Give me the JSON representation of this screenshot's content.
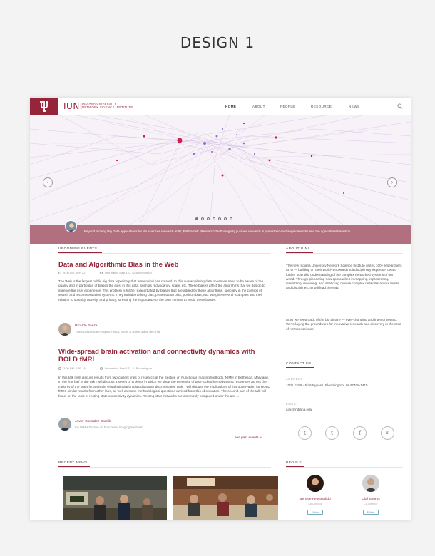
{
  "design_title": "DESIGN 1",
  "header": {
    "logo_mark": "IUNI",
    "org_line1": "INDIANA UNIVERSITY",
    "org_line2": "NETWORK SCIENCE INSTITUTE",
    "nav": [
      "HOME",
      "ABOUT",
      "PEOPLE",
      "RESOURCE",
      "NEWS"
    ],
    "active_nav": "HOME"
  },
  "hero": {
    "caption": "Beyond moving Big Data applications for life sciences research at IU, Bill Barnett (Research Technologies) pursues research in prehistoric exchange networks and the agricultural transition.",
    "slide_count": 7,
    "active_slide": 1
  },
  "events": {
    "section_label": "UPCOMING EVENTS",
    "items": [
      {
        "title": "Data and Algorithmic Bias in the Web",
        "time": "9:00 AM, APR 22",
        "location": "Informatics East 122, IU Bloomington",
        "description": "The Web is the largest public big data repository that humankind has created. In this overwhelming data ocean we need to be aware of the quality and in particular, of biases the exist in this data, such as redundancy, spam, etc. These biases affect the algorithms that we design to improve the user experience. This problem is further exacerbated by biases that are added by these algorithms, specially in the context of search and recommendation systems. They include ranking bias, presentation bias, position bias, etc. We give several examples and their relation to sparsity, novelty, and privacy, stressing the importance of the user context to avoid these biases.",
        "speaker": "Ricardo Baeza",
        "affiliation": "Yates Universitat Pompeu Fabra, Spain & Universidad de Chile"
      },
      {
        "title": "Wide-spread brain activation and connectivity dynamics with BOLD fMRI",
        "time": "3:00 PM, APR 18",
        "location": "Informatics East 122, IU Bloomington",
        "description": "In this talk I will discuss results from two current lines of research at the Section on Functional Imaging Methods, NIMH in Bethesda, Maryland. In the first half of the talk I will discuss a series of projects in which we show the presence of task-locked hemodynamic responses across the majority of the brain for a simple visual stimulation plus character discrimination task. I will discuss the implications of this observation for BOLD fMRI, similar results from other labs, as well as some methodological questions derived from this observation. The second part of the talk will focus on the topic of resting state connectivity dynamics. Resting state networks are commonly computed under the ass ...",
        "speaker": "Javier Gonzalez Castillo",
        "affiliation": "the NIMH Section on Functional Imaging Methods"
      }
    ],
    "see_past": "see past events >"
  },
  "about": {
    "section_label": "ABOUT IUNI",
    "para1": "The new Indiana University Network Science Institute unites 100+ researchers at IU — building on their world-renowned multidisciplinary expertise toward further scientific understanding of the complex networked systems of our world. Through pioneering new approaches in mapping, representing, visualizing, modeling, and analyzing diverse complex networks across levels and disciplines, IU will lead the way.",
    "para2": "At IU we keep track of the big picture — ever-changing and interconnected. We're laying the groundwork for innovative research and discovery in the area of network science."
  },
  "contact": {
    "section_label": "CONTACT US",
    "address_label": "ADDRESS",
    "address": "1001 E SR 45/46 Bypass, Bloomington, IN 47408-1415",
    "email_label": "EMAIL",
    "email": "iuni@indiana.edu",
    "social_icons": [
      "twitter-icon",
      "tumblr-icon",
      "facebook-icon",
      "linkedin-icon"
    ],
    "social_glyphs": [
      "t",
      "t",
      "f",
      "in"
    ]
  },
  "news": {
    "section_label": "RECENT NEWS"
  },
  "people": {
    "section_label": "PEOPLE",
    "items": [
      {
        "name": "Bernice Pescosolido",
        "role": "Co-Director",
        "follow": "Follow"
      },
      {
        "name": "Olaf Sporns",
        "role": "Co-Director",
        "follow": "Follow"
      }
    ]
  },
  "colors": {
    "brand": "#97253a",
    "caption_bg": "#b26f7f"
  }
}
